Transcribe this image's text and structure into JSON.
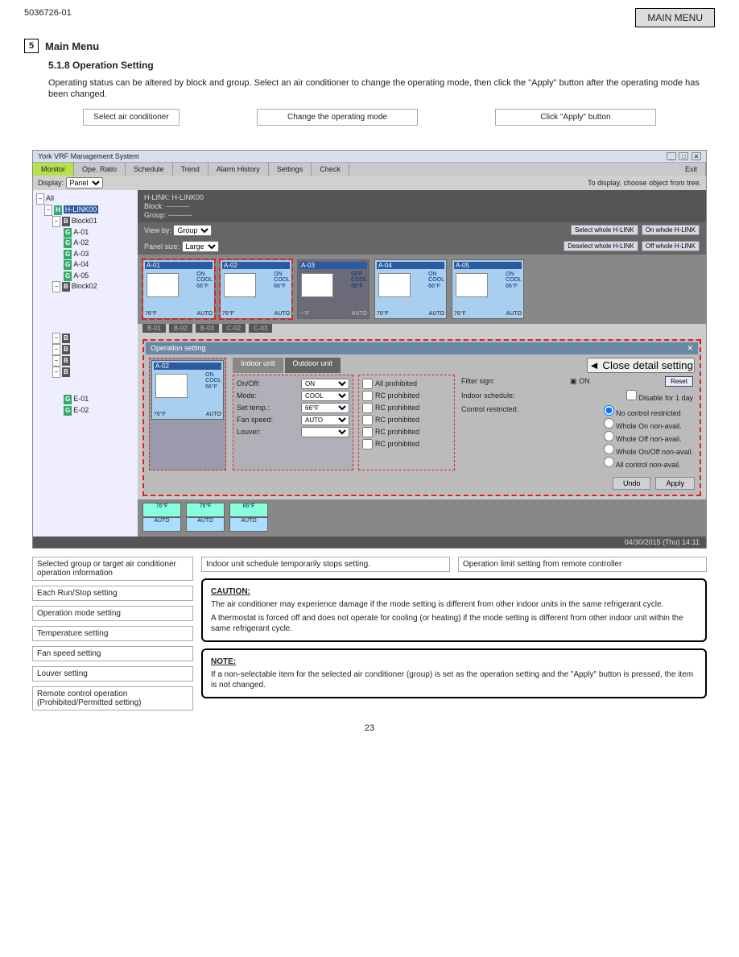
{
  "header": {
    "left": "5036726-01",
    "right": "MAIN MENU"
  },
  "section": {
    "number": "5",
    "title": "Main Menu",
    "subsection": "5.1.8 Operation Setting",
    "intro": "Operating status can be altered by block and group. Select an air conditioner to change the operating mode, then click the \"Apply\" button after the operating mode has been changed."
  },
  "top_callouts": [
    "Select air conditioner",
    "Change the operating mode",
    "Click \"Apply\" button"
  ],
  "window": {
    "title": "York VRF Management System",
    "wins": [
      "_",
      "□",
      "✕"
    ],
    "tabs": [
      "Monitor",
      "Ope. Ratio",
      "Schedule",
      "Trend",
      "Alarm History",
      "Settings",
      "Check"
    ],
    "tab_exit": "Exit",
    "display_label": "Display:",
    "display_value": "Panel",
    "hint": "To display, choose object from tree.",
    "status": "04/30/2015 (Thu) 14:11"
  },
  "tree": {
    "root": "All",
    "hlink": "H-LINK00",
    "blocks": [
      {
        "name": "Block01",
        "groups": [
          "A-01",
          "A-02",
          "A-03",
          "A-04",
          "A-05"
        ]
      },
      {
        "name": "Block02",
        "groups": []
      }
    ],
    "leafnodes": [
      "B",
      "B",
      "B",
      "B"
    ],
    "egroups": [
      "E-01",
      "E-02"
    ]
  },
  "infobar": {
    "hlink_label": "H-LINK:",
    "hlink_val": "H-LINK00",
    "block_label": "Block:",
    "block_val": "----------",
    "group_label": "Group:",
    "group_val": "----------"
  },
  "ctrlrow": {
    "viewby_label": "View by:",
    "viewby_val": "Group",
    "panelsize_label": "Panel size:",
    "panelsize_val": "Large",
    "btns": [
      "Select whole H-LINK",
      "On whole H-LINK",
      "Deselect whole H-LINK",
      "Off whole H-LINK"
    ]
  },
  "tiles": [
    {
      "name": "A-01",
      "on": true,
      "mode": "COOL",
      "temp": "66°F",
      "set": "76°F",
      "fan": "AUTO",
      "sel": true
    },
    {
      "name": "A-02",
      "on": true,
      "mode": "COOL",
      "temp": "66°F",
      "set": "76°F",
      "fan": "AUTO",
      "sel": true
    },
    {
      "name": "A-03",
      "on": false,
      "mode": "COOL",
      "temp": "66°F",
      "set": "--°F",
      "fan": "AUTO",
      "sel": false
    },
    {
      "name": "A-04",
      "on": true,
      "mode": "COOL",
      "temp": "66°F",
      "set": "76°F",
      "fan": "AUTO",
      "sel": false
    },
    {
      "name": "A-05",
      "on": true,
      "mode": "COOL",
      "temp": "66°F",
      "set": "76°F",
      "fan": "AUTO",
      "sel": false
    }
  ],
  "tilebot": [
    "B-01",
    "B-02",
    "B-03",
    "C-02",
    "C-03"
  ],
  "op": {
    "title": "Operation setting",
    "close": "✕",
    "subtabs": [
      "Indoor unit",
      "Outdoor unit"
    ],
    "card": {
      "name": "A-02",
      "on": "ON",
      "mode": "COOL",
      "temp": "66°F",
      "set": "76°F",
      "fan": "AUTO"
    },
    "rows": {
      "onoff_label": "On/Off:",
      "onoff": "ON",
      "mode_label": "Mode:",
      "mode": "COOL",
      "settemp_label": "Set temp.:",
      "settemp": "66°F",
      "fan_label": "Fan speed:",
      "fan": "AUTO",
      "louver_label": "Louver:",
      "louver": ""
    },
    "checks": [
      "All prohibited",
      "RC prohibited",
      "RC prohibited",
      "RC prohibited",
      "RC prohibited",
      "RC prohibited"
    ],
    "right": {
      "close_detail": "◄ Close detail setting",
      "filter_label": "Filter sign:",
      "filter_on": "ON",
      "reset": "Reset",
      "sched_label": "Indoor schedule:",
      "disable": "Disable for 1 day",
      "restrict_label": "Control restricted:",
      "radios": [
        "No control restricted",
        "Whole On non-avail.",
        "Whole Off non-avail.",
        "Whole On/Off non-avail.",
        "All control non-avail."
      ]
    },
    "footer": {
      "undo": "Undo",
      "apply": "Apply"
    }
  },
  "mini_tiles": [
    {
      "a": "76°F",
      "b": "AUTO"
    },
    {
      "a": "76°F",
      "b": "AUTO"
    },
    {
      "a": "66°F",
      "b": "AUTO"
    }
  ],
  "lower_left": [
    "Selected group or target air conditioner operation information",
    "Each Run/Stop setting",
    "Operation mode setting",
    "Temperature setting",
    "Fan speed setting",
    "Louver setting",
    "Remote control operation (Prohibited/Permitted setting)"
  ],
  "lower_right_pair": [
    "Indoor unit schedule temporarily stops setting.",
    "Operation limit setting from remote controller"
  ],
  "caution": {
    "title": "CAUTION:",
    "lines": [
      "The air conditioner may experience damage if the mode setting is different from other indoor units in the same refrigerant cycle.",
      "A thermostat is forced off and does not operate for cooling (or heating) if the mode setting is different from other indoor unit within the same refrigerant cycle."
    ]
  },
  "note": {
    "title": "NOTE:",
    "text": "If a non-selectable item for the selected air conditioner (group) is set as the operation setting and the \"Apply\" button is pressed, the item is not changed."
  },
  "page": "23"
}
